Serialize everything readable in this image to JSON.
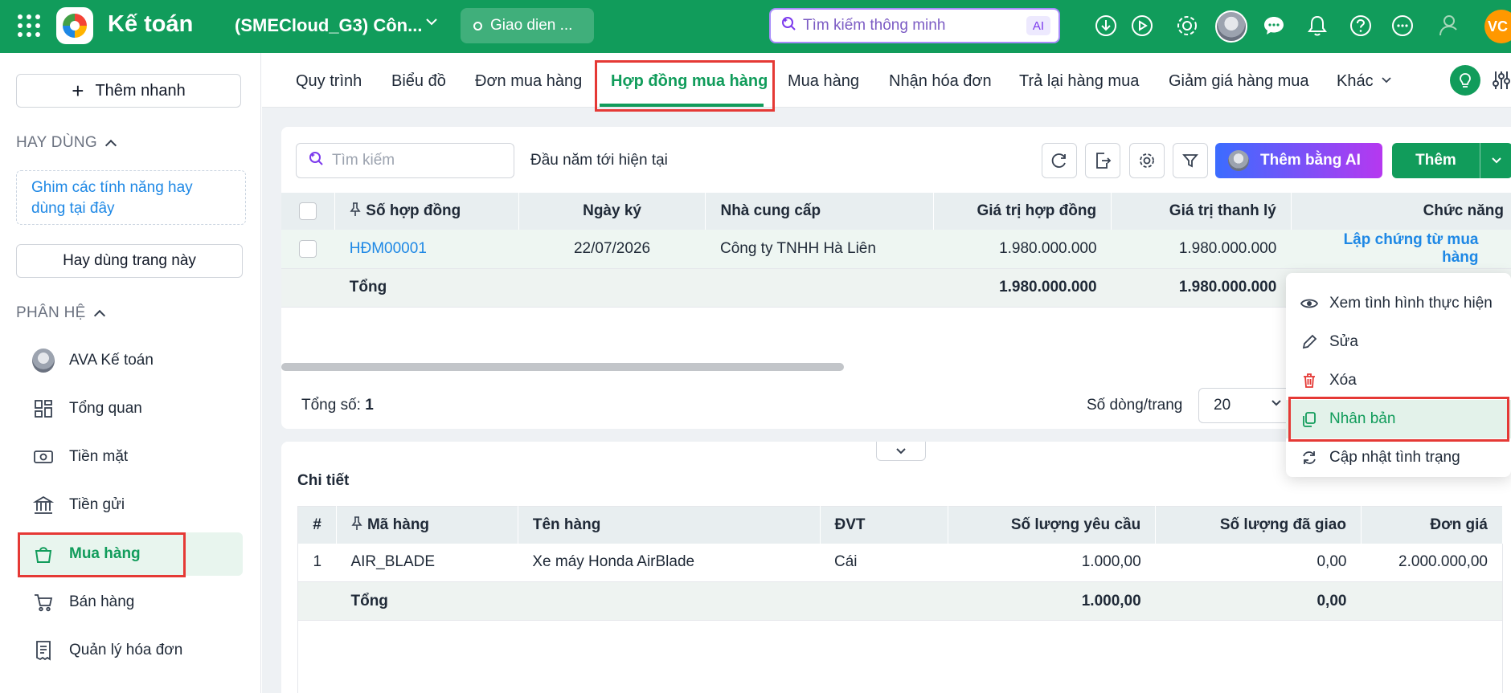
{
  "topbar": {
    "app_title": "Kế toán",
    "company": "(SMECloud_G3) Côn...",
    "theme_label": "Giao dien ...",
    "smart_search_placeholder": "Tìm kiếm thông minh",
    "ai_chip": "AI",
    "user_initials": "VC"
  },
  "sidebar": {
    "quick_add": "Thêm nhanh",
    "frequent_header": "HAY DÙNG",
    "pin_hint": "Ghim các tính năng hay dùng tại đây",
    "frequent_button": "Hay dùng trang này",
    "modules_header": "PHÂN HỆ",
    "items": [
      {
        "label": "AVA Kế toán",
        "icon": "ava-avatar-icon"
      },
      {
        "label": "Tổng quan",
        "icon": "dashboard-icon"
      },
      {
        "label": "Tiền mặt",
        "icon": "cash-icon"
      },
      {
        "label": "Tiền gửi",
        "icon": "bank-icon"
      },
      {
        "label": "Mua hàng",
        "icon": "shopping-bag-icon"
      },
      {
        "label": "Bán hàng",
        "icon": "cart-icon"
      },
      {
        "label": "Quản lý hóa đơn",
        "icon": "invoice-icon"
      }
    ]
  },
  "tabs": [
    "Quy trình",
    "Biểu đồ",
    "Đơn mua hàng",
    "Hợp đồng mua hàng",
    "Mua hàng",
    "Nhận hóa đơn",
    "Trả lại hàng mua",
    "Giảm giá hàng mua",
    "Khác"
  ],
  "toolbar": {
    "search_placeholder": "Tìm kiếm",
    "period": "Đầu năm tới hiện tại",
    "ai_add_label": "Thêm bằng AI",
    "add_label": "Thêm"
  },
  "contracts": {
    "columns": [
      "Số hợp đồng",
      "Ngày ký",
      "Nhà cung cấp",
      "Giá trị hợp đồng",
      "Giá trị thanh lý",
      "Chức năng"
    ],
    "rows": [
      {
        "number": "HĐM00001",
        "date": "22/07/2026",
        "supplier": "Công ty TNHH Hà Liên",
        "value": "1.980.000.000",
        "liquidation": "1.980.000.000",
        "action": "Lập chứng từ mua hàng"
      }
    ],
    "total_label": "Tổng",
    "total_value": "1.980.000.000",
    "total_liquidation": "1.980.000.000",
    "count_label": "Tổng số:",
    "count_value": "1",
    "rows_per_page_label": "Số dòng/trang",
    "rows_per_page": "20"
  },
  "action_menu": [
    {
      "label": "Xem tình hình thực hiện",
      "icon": "eye-icon"
    },
    {
      "label": "Sửa",
      "icon": "pencil-icon"
    },
    {
      "label": "Xóa",
      "icon": "trash-icon"
    },
    {
      "label": "Nhân bản",
      "icon": "copy-icon"
    },
    {
      "label": "Cập nhật tình trạng",
      "icon": "refresh-icon"
    }
  ],
  "detail": {
    "title": "Chi tiết",
    "columns": [
      "#",
      "Mã hàng",
      "Tên hàng",
      "ĐVT",
      "Số lượng yêu cầu",
      "Số lượng đã giao",
      "Đơn giá"
    ],
    "rows": [
      {
        "no": "1",
        "code": "AIR_BLADE",
        "name": "Xe máy Honda AirBlade",
        "unit": "Cái",
        "qty_req": "1.000,00",
        "qty_del": "0,00",
        "price": "2.000.000,00"
      }
    ],
    "total_label": "Tổng",
    "total_qty_req": "1.000,00",
    "total_qty_del": "0,00"
  },
  "colors": {
    "brand": "#119c5b",
    "link": "#1e88e5",
    "highlight": "#e53935"
  }
}
